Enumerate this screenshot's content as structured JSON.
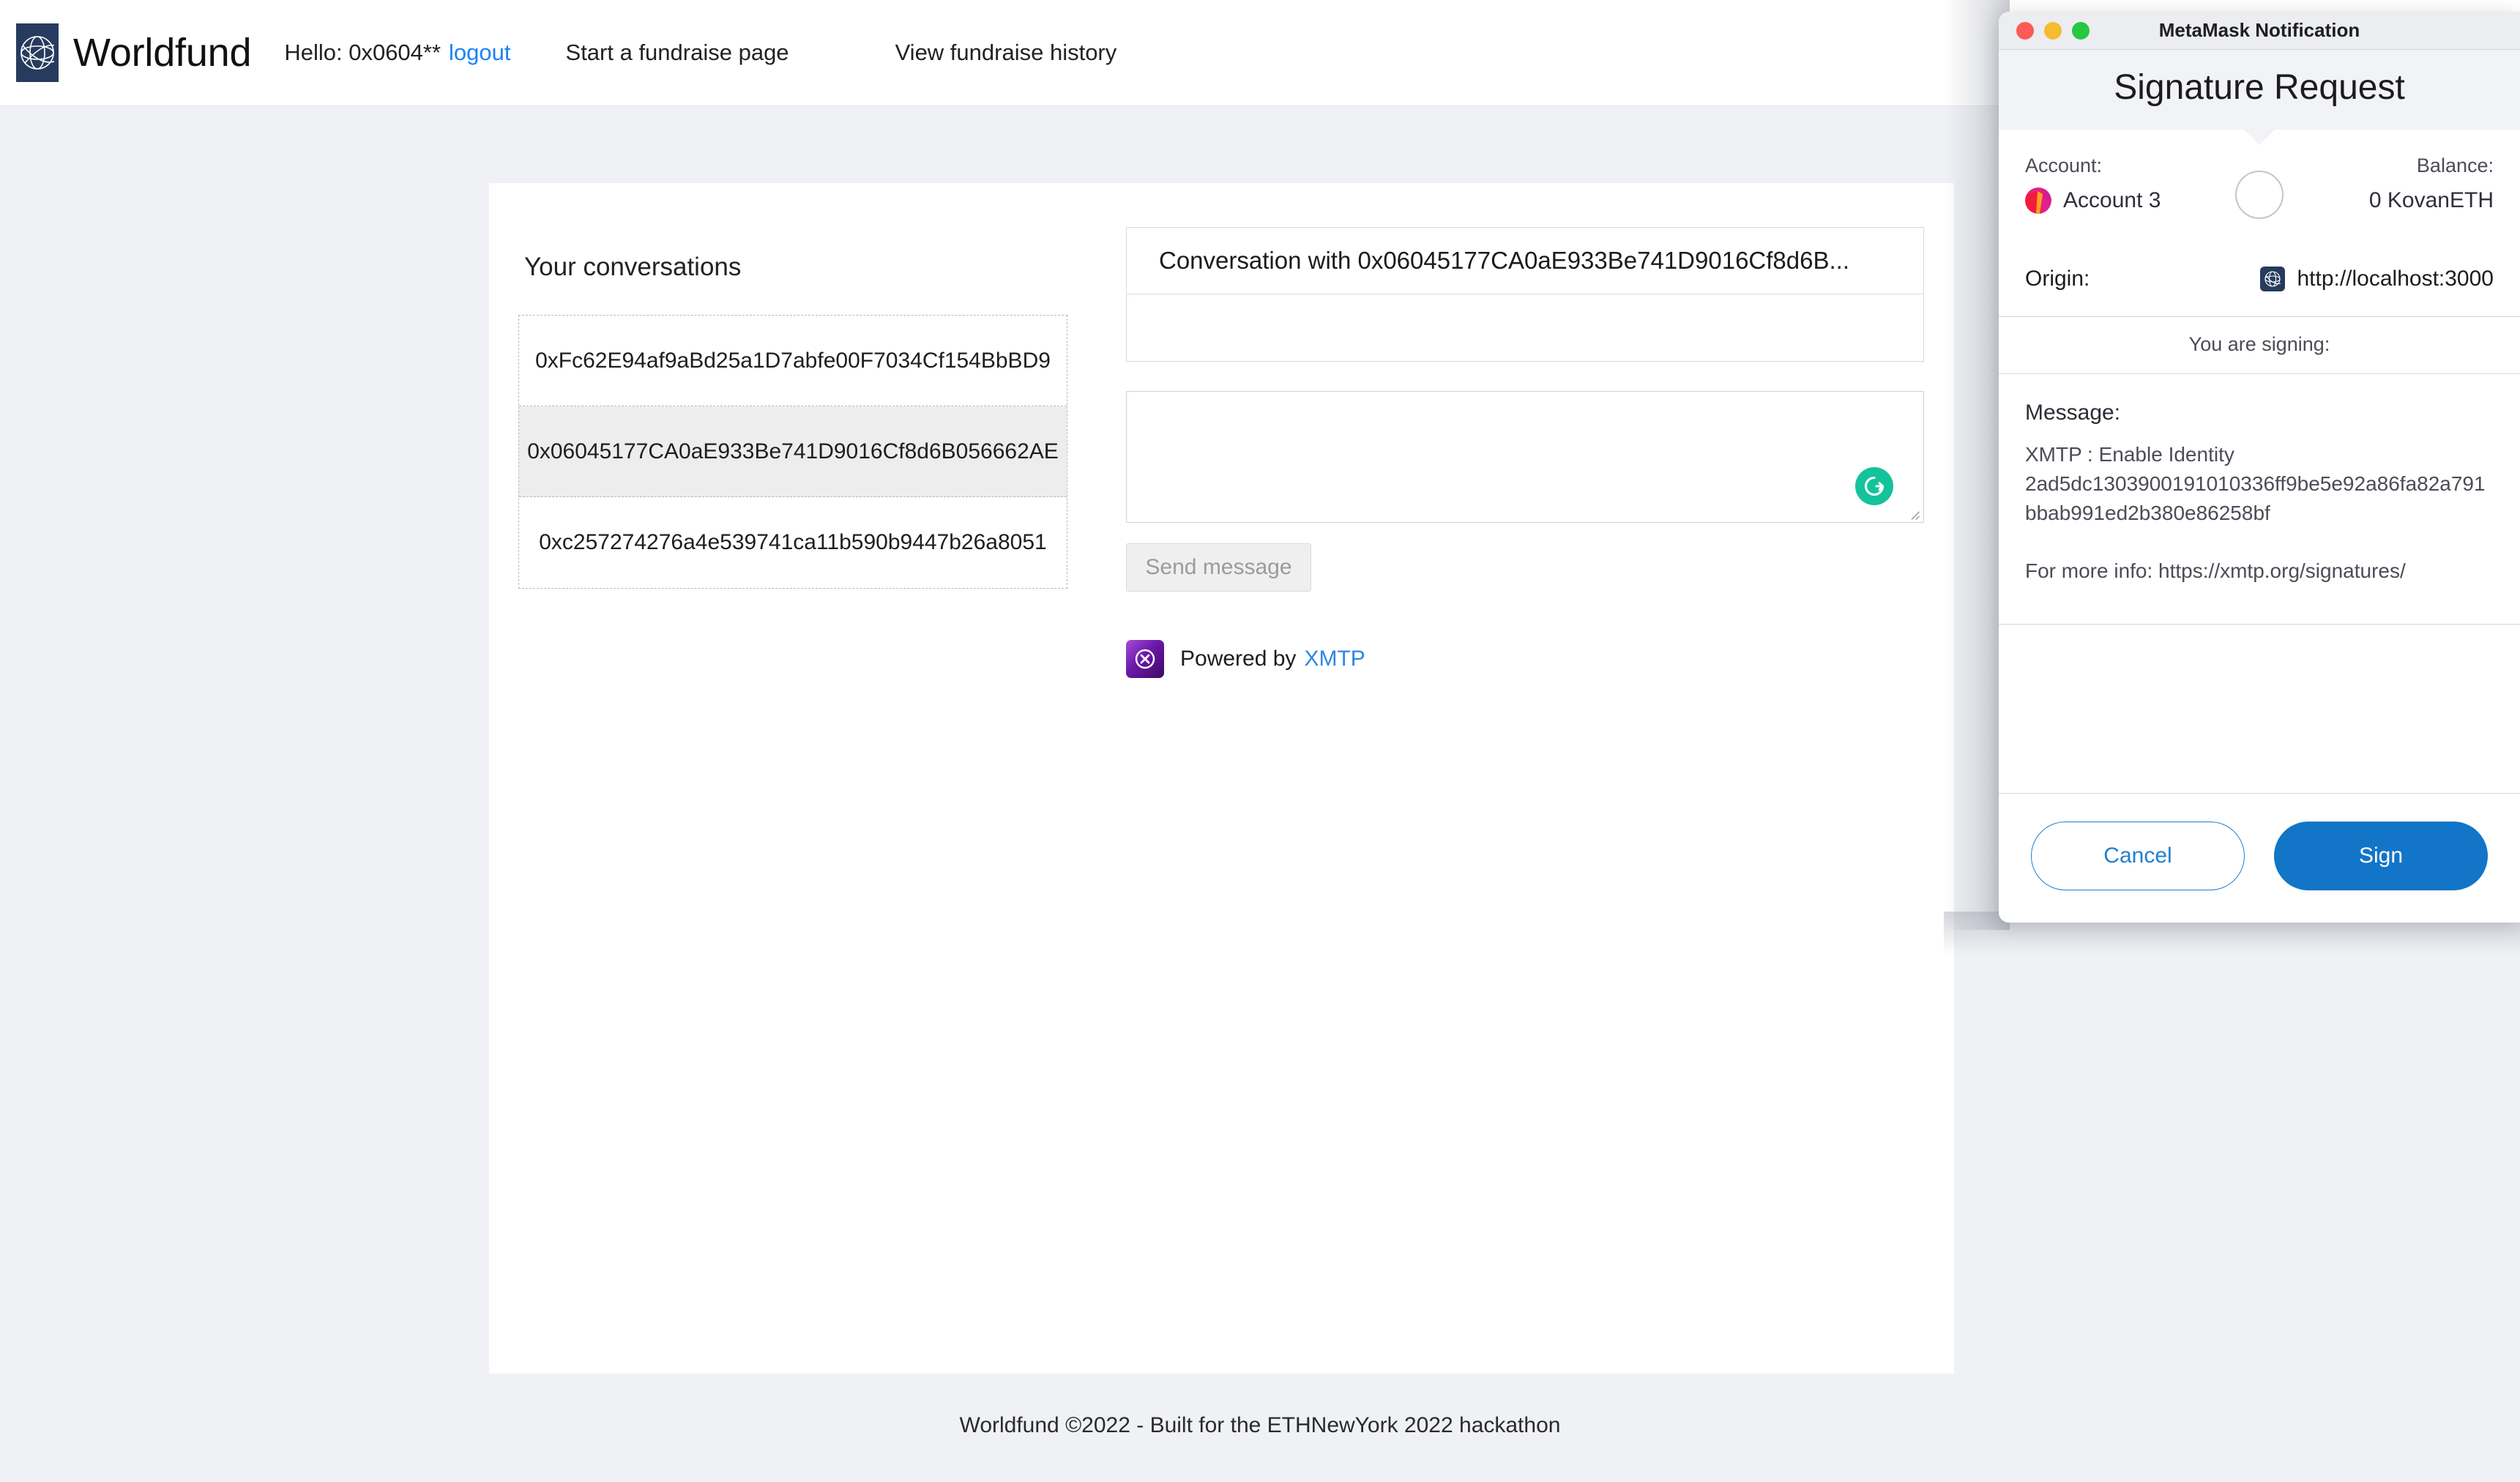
{
  "navbar": {
    "brand": "Worldfund",
    "brand_logo_icon": "globe-wireframe-icon",
    "hello_text": "Hello: 0x0604**",
    "logout_label": "logout",
    "start_fundraise_label": "Start a fundraise page",
    "view_history_label": "View fundraise history"
  },
  "main": {
    "conversations_title": "Your conversations",
    "conversations": [
      {
        "address": "0xFc62E94af9aBd25a1D7abfe00F7034Cf154BbBD9",
        "selected": false
      },
      {
        "address": "0x06045177CA0aE933Be741D9016Cf8d6B056662AE",
        "selected": true
      },
      {
        "address": "0xc257274276a4e539741ca11b590b9447b26a8051",
        "selected": false
      }
    ],
    "chat": {
      "header": "Conversation with 0x06045177CA0aE933Be741D9016Cf8d6B...",
      "messages": [],
      "compose_value": "",
      "compose_placeholder": "",
      "grammarly_icon": "grammarly-icon",
      "send_label": "Send message"
    },
    "powered": {
      "logo_icon": "xmtp-logo-icon",
      "prefix": "Powered by",
      "link_label": "XMTP"
    }
  },
  "footer": {
    "text": "Worldfund ©2022 - Built for the ETHNewYork 2022 hackathon"
  },
  "metamask": {
    "window_title": "MetaMask Notification",
    "traffic_lights": [
      "close-red",
      "minimize-yellow",
      "zoom-green"
    ],
    "heading": "Signature Request",
    "account_label": "Account:",
    "account_name": "Account 3",
    "account_avatar_icon": "jazzicon-avatar",
    "balance_label": "Balance:",
    "balance_value": "0 KovanETH",
    "origin_label": "Origin:",
    "origin_favicon_icon": "worldfund-favicon-icon",
    "origin_url": "http://localhost:3000",
    "signing_label": "You are signing:",
    "message_label": "Message:",
    "message_line1": "XMTP : Enable Identity",
    "message_hash": "2ad5dc1303900191010336ff9be5e92a86fa82a791bbab991ed2b380e86258bf",
    "message_info": "For more info: https://xmtp.org/signatures/",
    "cancel_label": "Cancel",
    "sign_label": "Sign"
  },
  "colors": {
    "page_bg": "#f0f1f5",
    "link_blue": "#1a82f5",
    "xmtp_blue": "#2f86e0",
    "brand_navy": "#273b5e",
    "grammarly_green": "#15c39a",
    "mm_primary": "#1275c7",
    "mm_outline": "#1f7fd1"
  }
}
